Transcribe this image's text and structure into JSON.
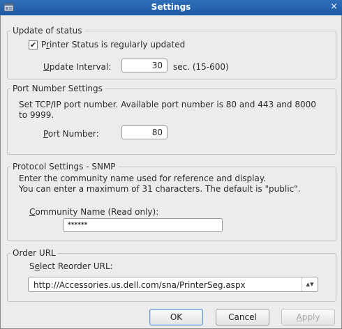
{
  "window": {
    "title": "Settings",
    "close_glyph": "×",
    "icon": "printer-settings-icon"
  },
  "status_group": {
    "legend": "Update of status",
    "checkbox_checked": true,
    "checkbox_label_pre": "P",
    "checkbox_label_mn": "r",
    "checkbox_label_post": "inter Status is regularly updated",
    "interval_label_mn": "U",
    "interval_label_post": "pdate Interval:",
    "interval_value": "30",
    "interval_unit": "sec. (15-600)"
  },
  "port_group": {
    "legend": "Port Number Settings",
    "description_line1": "Set TCP/IP port number. Available port number is 80 and 443 and 8000",
    "description_line2": "to 9999.",
    "port_label_mn": "P",
    "port_label_post": "ort Number:",
    "port_value": "80"
  },
  "snmp_group": {
    "legend": "Protocol Settings - SNMP",
    "description_line1": "Enter the community name used for reference and display.",
    "description_line2": "You can enter a maximum of 31 characters. The default is \"public\".",
    "community_label_mn": "C",
    "community_label_post": "ommunity Name (Read only):",
    "community_value": "******"
  },
  "order_group": {
    "legend": "Order URL",
    "select_label_pre": "S",
    "select_label_mn": "e",
    "select_label_post": "lect Reorder URL:",
    "selected_url": "http://Accessories.us.dell.com/sna/PrinterSeg.aspx",
    "arrow_glyph": "▴▾"
  },
  "buttons": {
    "ok": "OK",
    "cancel": "Cancel",
    "apply_mn": "A",
    "apply_post": "pply"
  }
}
